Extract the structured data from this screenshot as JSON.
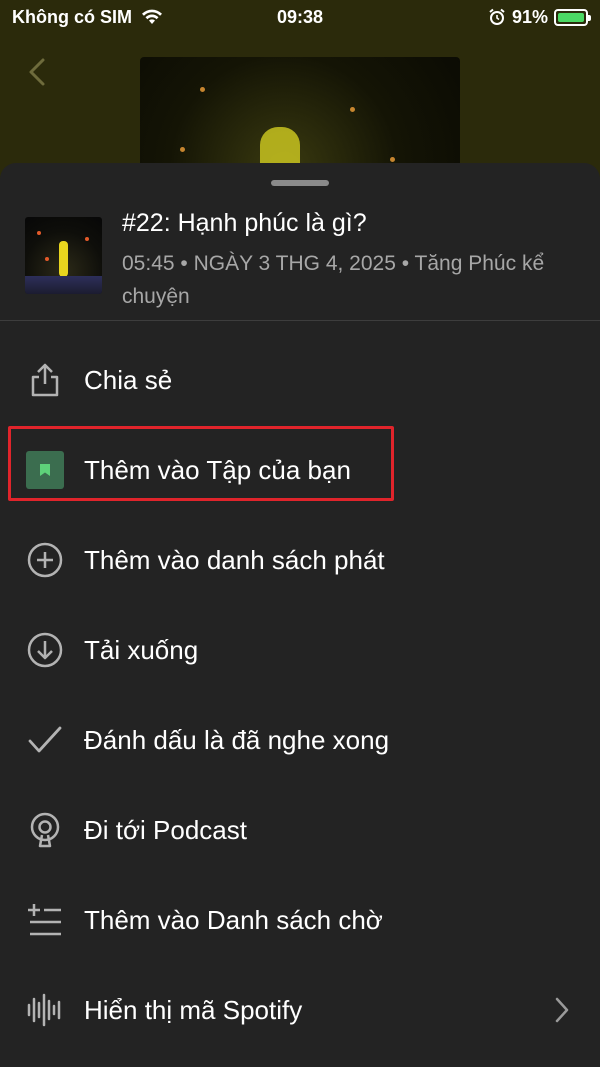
{
  "status_bar": {
    "carrier": "Không có SIM",
    "time": "09:38",
    "battery_percent": "91%",
    "battery_level": 0.91
  },
  "episode": {
    "title": "#22: Hạnh phúc là gì?",
    "meta": "05:45 • NGÀY 3 THG 4, 2025 • Tăng Phúc kể chuyện"
  },
  "menu": {
    "items": [
      {
        "label": "Chia sẻ",
        "icon": "share-icon"
      },
      {
        "label": "Thêm vào Tập của bạn",
        "icon": "bookmark-icon"
      },
      {
        "label": "Thêm vào danh sách phát",
        "icon": "plus-circle-icon"
      },
      {
        "label": "Tải xuống",
        "icon": "download-icon"
      },
      {
        "label": "Đánh dấu là đã nghe xong",
        "icon": "check-icon"
      },
      {
        "label": "Đi tới Podcast",
        "icon": "podcast-icon"
      },
      {
        "label": "Thêm vào Danh sách chờ",
        "icon": "queue-add-icon"
      },
      {
        "label": "Hiển thị mã Spotify",
        "icon": "spotify-code-icon"
      }
    ]
  },
  "colors": {
    "sheet_background": "#232323",
    "highlight_border": "#e0242b",
    "bookmark_accent": "#3b6d4f",
    "battery_fill": "#4cd964"
  }
}
